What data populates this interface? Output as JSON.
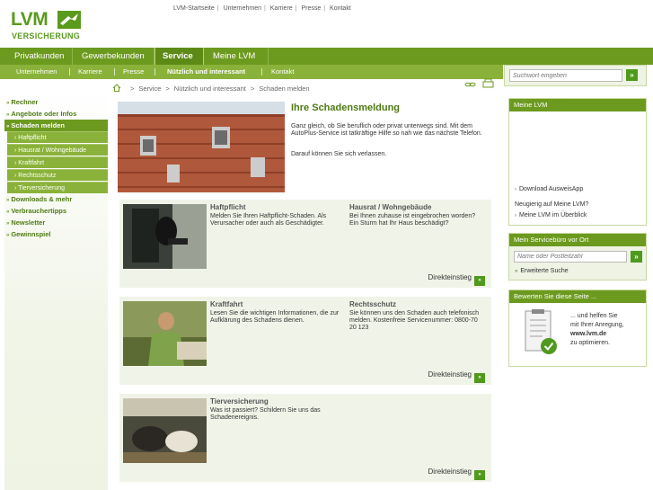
{
  "brand": {
    "logo_text": "LVM",
    "logo_sub": "VERSICHERUNG"
  },
  "topnav": [
    "LVM-Startseite",
    "Unternehmen",
    "Karriere",
    "Presse",
    "Kontakt"
  ],
  "mainnav": {
    "tabs": [
      {
        "label": "Privatkunden",
        "active": false
      },
      {
        "label": "Gewerbekunden",
        "active": false
      },
      {
        "label": "Service",
        "active": true
      },
      {
        "label": "Meine LVM",
        "active": false
      }
    ]
  },
  "subnav": {
    "items": [
      {
        "label": "Unternehmen",
        "active": false
      },
      {
        "label": "Karriere",
        "active": false
      },
      {
        "label": "Presse",
        "active": false
      },
      {
        "label": "Nützlich und interessant",
        "active": true
      },
      {
        "label": "Kontakt",
        "active": false
      }
    ]
  },
  "search": {
    "placeholder": "Suchwort eingeben",
    "go_label": "»"
  },
  "leftnav": {
    "items": [
      {
        "label": "Rechner"
      },
      {
        "label": "Angebote oder Infos"
      },
      {
        "label": "Schaden melden",
        "active": true
      },
      {
        "label": "Downloads & mehr"
      },
      {
        "label": "Verbrauchertipps"
      },
      {
        "label": "Newsletter"
      },
      {
        "label": "Gewinnspiel"
      }
    ],
    "subitems": [
      "Haftpflicht",
      "Hausrat / Wohngebäude",
      "Kraftfahrt",
      "Rechtsschutz",
      "Tierversicherung"
    ],
    "arrow": "»",
    "sub_arrow": "›"
  },
  "breadcrumb": [
    "Service",
    "Nützlich und interessant",
    "Schaden melden"
  ],
  "hero": {
    "title": "Ihre Schadensmeldung",
    "text1": "Ganz gleich, ob Sie beruflich oder privat unterwegs sind. Mit dem AutoPlus-Service ist tatkräftige Hilfe so nah wie das nächste Telefon.",
    "text2": "Darauf können Sie sich verlassen."
  },
  "cards": [
    {
      "col1": {
        "title": "Haftpflicht",
        "text": "Melden Sie Ihren Haftpflicht-Schaden. Als Verursacher oder auch als Geschädigter."
      },
      "col2": {
        "title": "Hausrat / Wohngebäude",
        "text": "Bei Ihnen zuhause ist eingebrochen worden? Ein Sturm hat Ihr Haus beschädigt?"
      },
      "link": "Direkteinstieg"
    },
    {
      "col1": {
        "title": "Kraftfahrt",
        "text": "Lesen Sie die wichtigen Informationen, die zur Aufklärung des Schadens dienen."
      },
      "col2": {
        "title": "Rechtsschutz",
        "text": "Sie können uns den Schaden auch telefonisch melden. Kostenfreie Servicenummer: 0800-70 20 123"
      },
      "link": "Direkteinstieg"
    },
    {
      "col1": {
        "title": "Tierversicherung",
        "text": "Was ist passiert? Schildern Sie uns das Schadenereignis."
      },
      "link": "Direkteinstieg"
    }
  ],
  "direkt_arrow": "»",
  "meine_lvm": {
    "title": "Meine LVM",
    "download": "Download AusweisApp",
    "question": "Neugierig auf Meine LVM?",
    "overview": "Meine LVM im Überblick"
  },
  "servicebuero": {
    "title": "Mein Servicebüro vor Ort",
    "placeholder": "Name oder Postleitzahl",
    "extended": "Erweiterte Suche"
  },
  "bewerten": {
    "title": "Bewerten Sie diese Seite ...",
    "line1": "... und helfen Sie",
    "line2": "mit Ihrer Anregung,",
    "line3": "www.lvm.de",
    "line4": "zu optimieren."
  },
  "colors": {
    "brand_green": "#6c9a1f",
    "light_green": "#8ab23a",
    "card_bg": "#f0f4e8",
    "button_green": "#4f9a1d"
  }
}
